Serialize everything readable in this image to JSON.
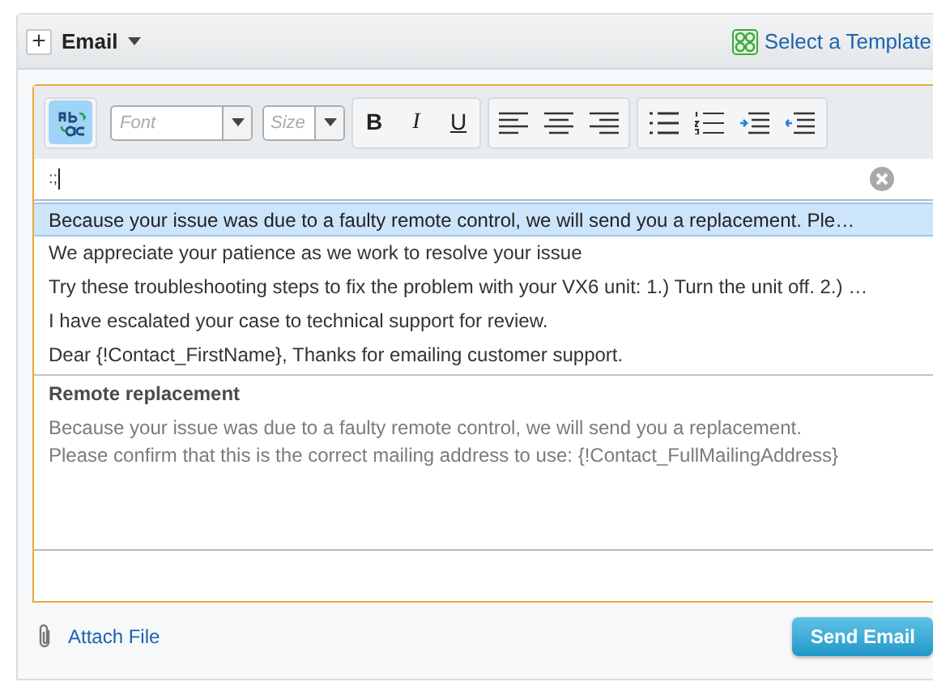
{
  "header": {
    "add_label": "+",
    "title": "Email",
    "template_link": "Select a Template"
  },
  "toolbar": {
    "spellcheck": {
      "active": true
    },
    "font": {
      "placeholder": "Font"
    },
    "size": {
      "placeholder": "Size"
    },
    "format_buttons": [
      "B",
      "I",
      "U"
    ]
  },
  "editor": {
    "value": ":;"
  },
  "suggestions": [
    {
      "text": "Because your issue was due to a faulty remote control, we will send you a replacement. Ple…",
      "selected": true
    },
    {
      "text": "We appreciate your patience as we work to resolve your issue",
      "selected": false
    },
    {
      "text": "Try these troubleshooting steps to fix the problem with your VX6 unit: 1.) Turn the unit off. 2.) …",
      "selected": false
    },
    {
      "text": "I have escalated your case to technical support for review.",
      "selected": false
    },
    {
      "text": "Dear {!Contact_FirstName}, Thanks for emailing customer support.",
      "selected": false
    }
  ],
  "preview": {
    "title": "Remote replacement",
    "lines": [
      "Because your issue was due to a faulty remote control, we will send you a replacement.",
      "Please confirm that this is the correct mailing address to use: {!Contact_FullMailingAddress}"
    ]
  },
  "footer": {
    "attach_label": "Attach File",
    "send_label": "Send Email"
  }
}
